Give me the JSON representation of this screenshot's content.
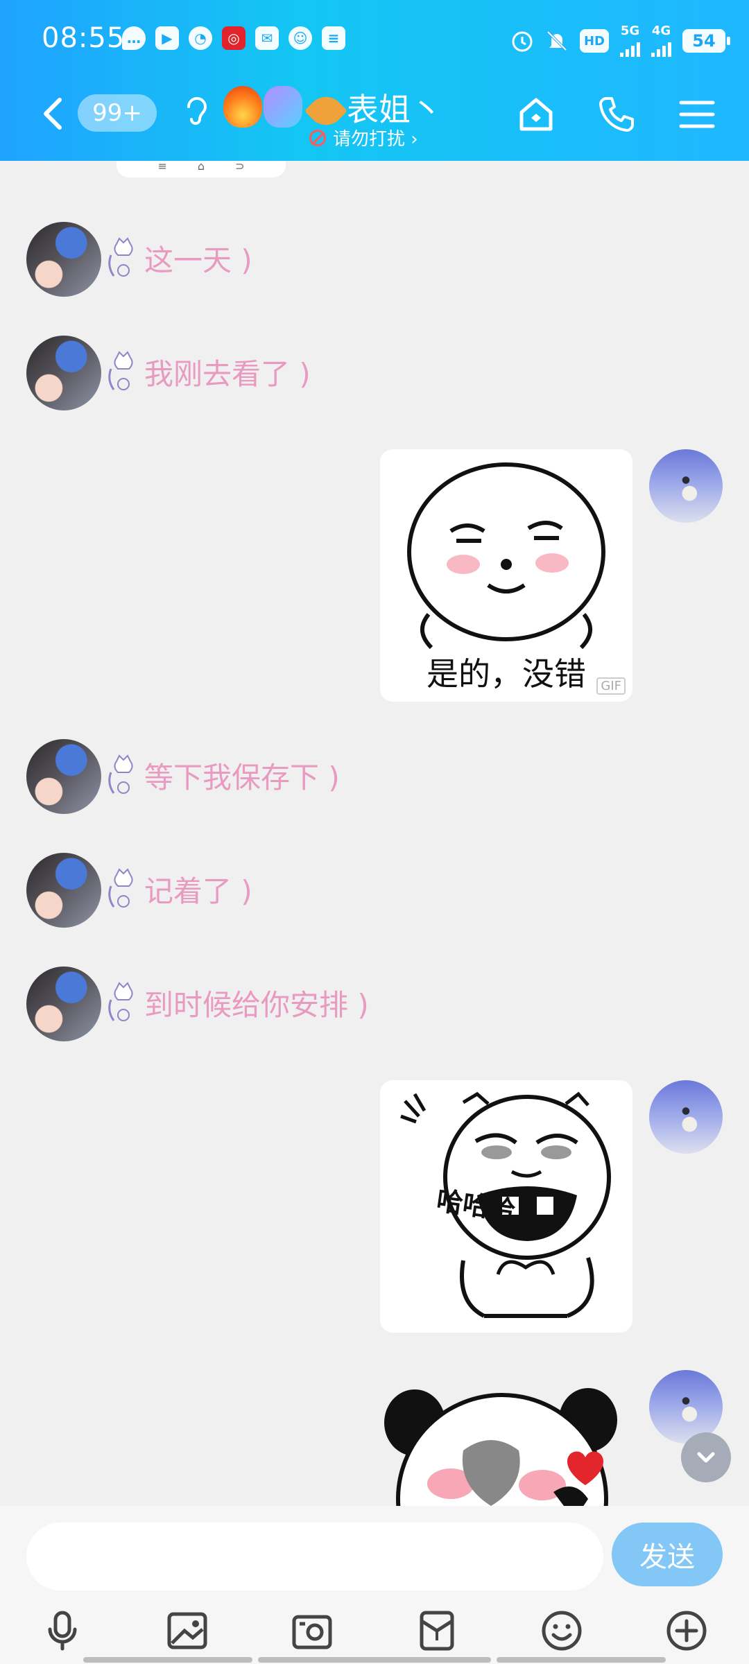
{
  "status_bar": {
    "time": "08:55",
    "network_1": "5G",
    "network_2": "4G",
    "battery": "54",
    "hd_label": "HD"
  },
  "header": {
    "unread_count": "99+",
    "contact_name": "表姐丶",
    "dnd_status": "请勿打扰 ›"
  },
  "messages": [
    {
      "side": "left",
      "text": "这一天"
    },
    {
      "side": "left",
      "text": "我刚去看了"
    },
    {
      "side": "right",
      "type": "sticker",
      "caption": "是的，没错",
      "tag": "GIF"
    },
    {
      "side": "left",
      "text": "等下我保存下"
    },
    {
      "side": "left",
      "text": "记着了"
    },
    {
      "side": "left",
      "text": "到时候给你安排"
    },
    {
      "side": "right",
      "type": "sticker",
      "caption": "哈哈哈"
    },
    {
      "side": "right",
      "type": "sticker",
      "caption": ""
    }
  ],
  "input": {
    "placeholder": "",
    "send_label": "发送"
  },
  "colors": {
    "header_start": "#1fa3ff",
    "header_end": "#14c6f3",
    "bubble_text": "#e89ac0",
    "send_button": "#82c7f5"
  },
  "icons": {
    "toolbar": [
      "microphone-icon",
      "image-icon",
      "camera-icon",
      "red-packet-icon",
      "emoji-icon",
      "plus-icon"
    ],
    "nav": [
      "back-icon",
      "ear-icon",
      "home-icon",
      "phone-icon",
      "menu-icon"
    ]
  }
}
